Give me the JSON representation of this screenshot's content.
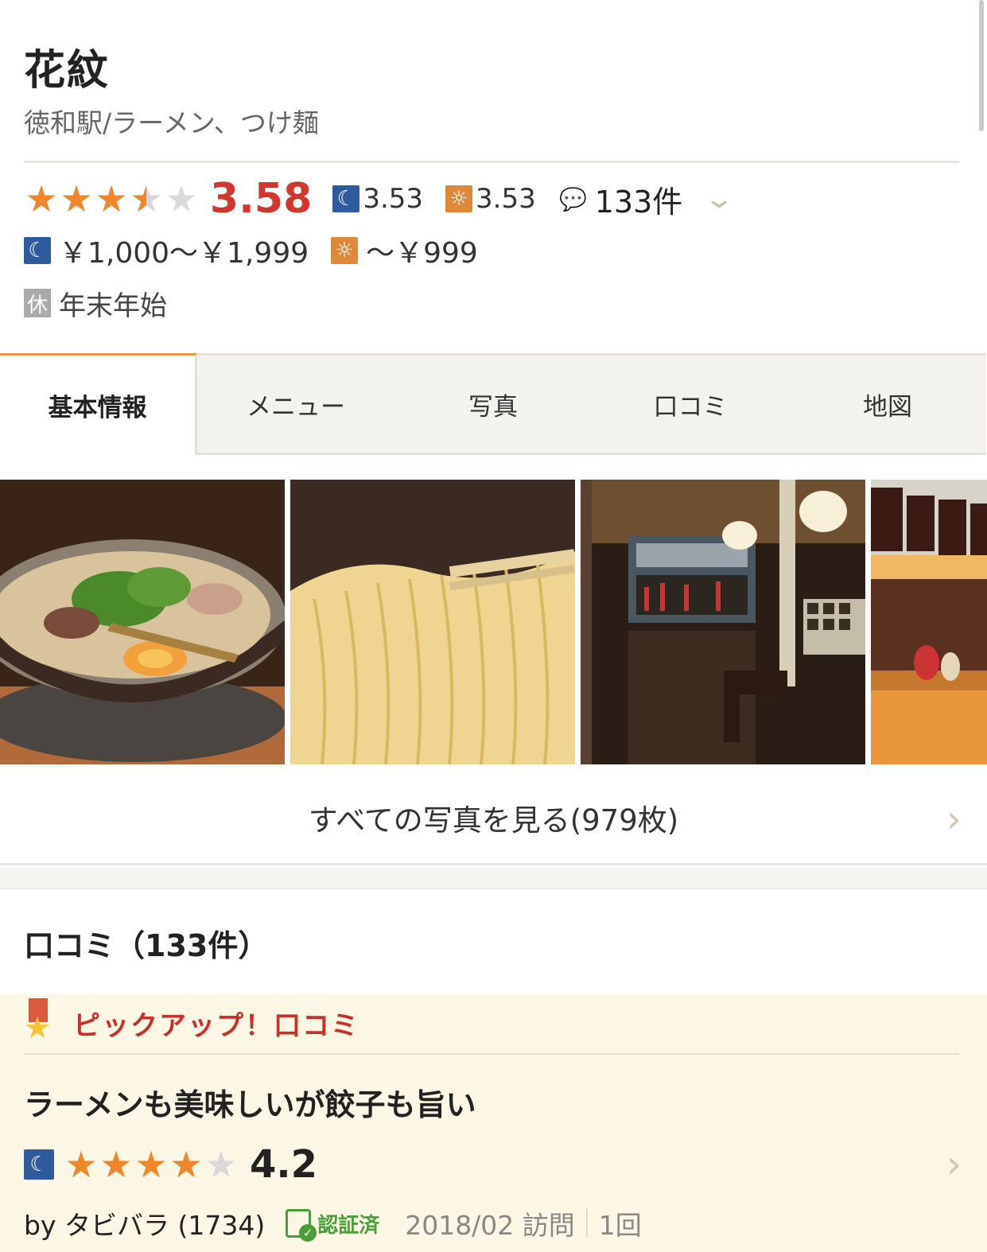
{
  "shop": {
    "name": "花紋",
    "genre": "徳和駅/ラーメン、つけ麺",
    "rating": "3.58",
    "rating_value": 3.58,
    "night_score": "3.53",
    "day_score": "3.53",
    "review_count": "133件",
    "budget_night": "￥1,000～￥1,999",
    "budget_day": "～￥999",
    "holiday_badge": "休",
    "holiday": "年末年始"
  },
  "icons": {
    "night": "moon-icon",
    "day": "sun-icon",
    "comment": "speech-bubble-icon",
    "expand": "chevron-down-icon"
  },
  "tabs": [
    {
      "label": "基本情報",
      "active": true
    },
    {
      "label": "メニュー",
      "active": false
    },
    {
      "label": "写真",
      "active": false
    },
    {
      "label": "口コミ",
      "active": false
    },
    {
      "label": "地図",
      "active": false
    }
  ],
  "photos": {
    "all_label": "すべての写真を見る(979枚)"
  },
  "reviews": {
    "heading": "口コミ（133件）",
    "pickup_label": "ピックアップ！口コミ",
    "pickup": {
      "title": "ラーメンも美味しいが餃子も旨い",
      "score": "4.2",
      "score_value": 4.2,
      "by": "by タビバラ (1734)",
      "verified": "認証済",
      "visit": "2018/02 訪問",
      "times": "1回"
    }
  },
  "colors": {
    "accent_orange": "#f0862a",
    "score_red": "#d3362e",
    "night_blue": "#2f5a9e",
    "day_orange": "#e0883a",
    "pickup_bg": "#fbf7e4",
    "pickup_red": "#c8312a",
    "verified_green": "#4a9e3a"
  }
}
